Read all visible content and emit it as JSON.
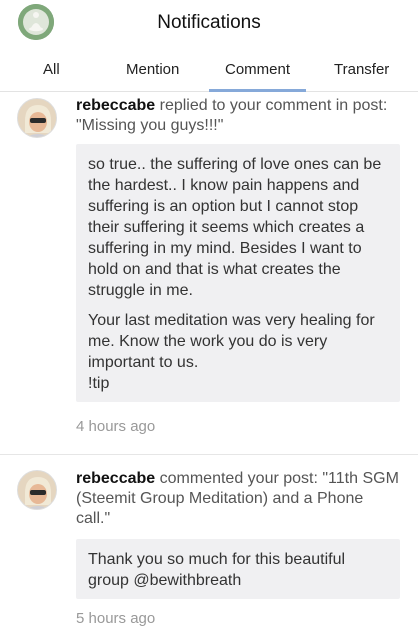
{
  "header": {
    "title": "Notifications"
  },
  "tabs": [
    {
      "label": "All"
    },
    {
      "label": "Mention"
    },
    {
      "label": "Comment"
    },
    {
      "label": "Transfer"
    }
  ],
  "active_tab": "Comment",
  "notifications": [
    {
      "user": "rebeccabe",
      "action": "replied to your comment in post: \"Missing you guys!!!\"",
      "quote": [
        "so true.. the suffering of love ones can be the hardest.. I know pain happens and suffering is an option but I cannot stop their suffering it seems which creates a suffering in my mind. Besides I want to hold on and that is what creates the struggle in me.",
        "Your last meditation was very healing for me. Know the work you do is very important to us.",
        "!tip"
      ],
      "time": "4 hours ago"
    },
    {
      "user": "rebeccabe",
      "action": "commented your post: \"11th SGM (Steemit Group Meditation) and a Phone call.\"",
      "quote": [
        "Thank you so much for this beautiful group @bewithbreath"
      ],
      "time": "5 hours ago"
    }
  ],
  "colors": {
    "tab_indicator": "#86a9d9",
    "quote_bg": "#f0f0f2",
    "time": "#999999"
  }
}
